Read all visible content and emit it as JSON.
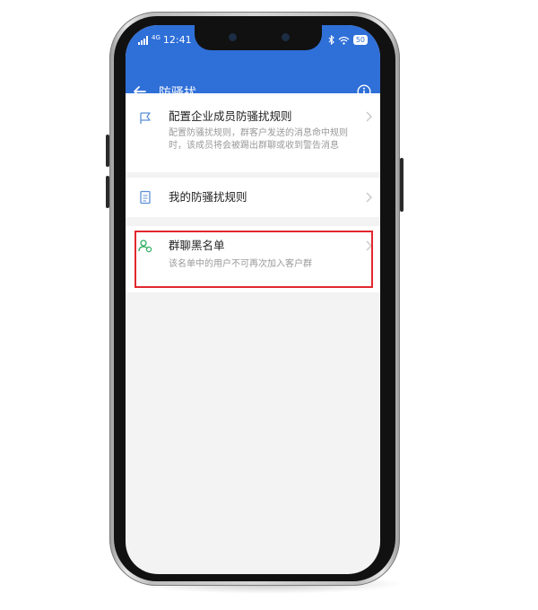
{
  "status_bar": {
    "time": "12:41",
    "signal": "4G",
    "battery": "50"
  },
  "header": {
    "title": "防骚扰"
  },
  "items": [
    {
      "title": "配置企业成员防骚扰规则",
      "description": "配置防骚扰规则，群客户发送的消息命中规则时，该成员将会被踢出群聊或收到警告消息"
    },
    {
      "title": "我的防骚扰规则",
      "description": ""
    },
    {
      "title": "群聊黑名单",
      "description": "该名单中的用户不可再次加入客户群"
    }
  ],
  "colors": {
    "header_bg": "#2f6fd8",
    "highlight_border": "#e1282e",
    "icon_blue": "#5b8fd6",
    "icon_green": "#2fae62"
  },
  "icons": {
    "back": "arrow-left-icon",
    "info": "info-icon",
    "item1": "flag-icon",
    "item2": "document-icon",
    "item3": "user-group-icon",
    "chevron": "chevron-right-icon"
  }
}
